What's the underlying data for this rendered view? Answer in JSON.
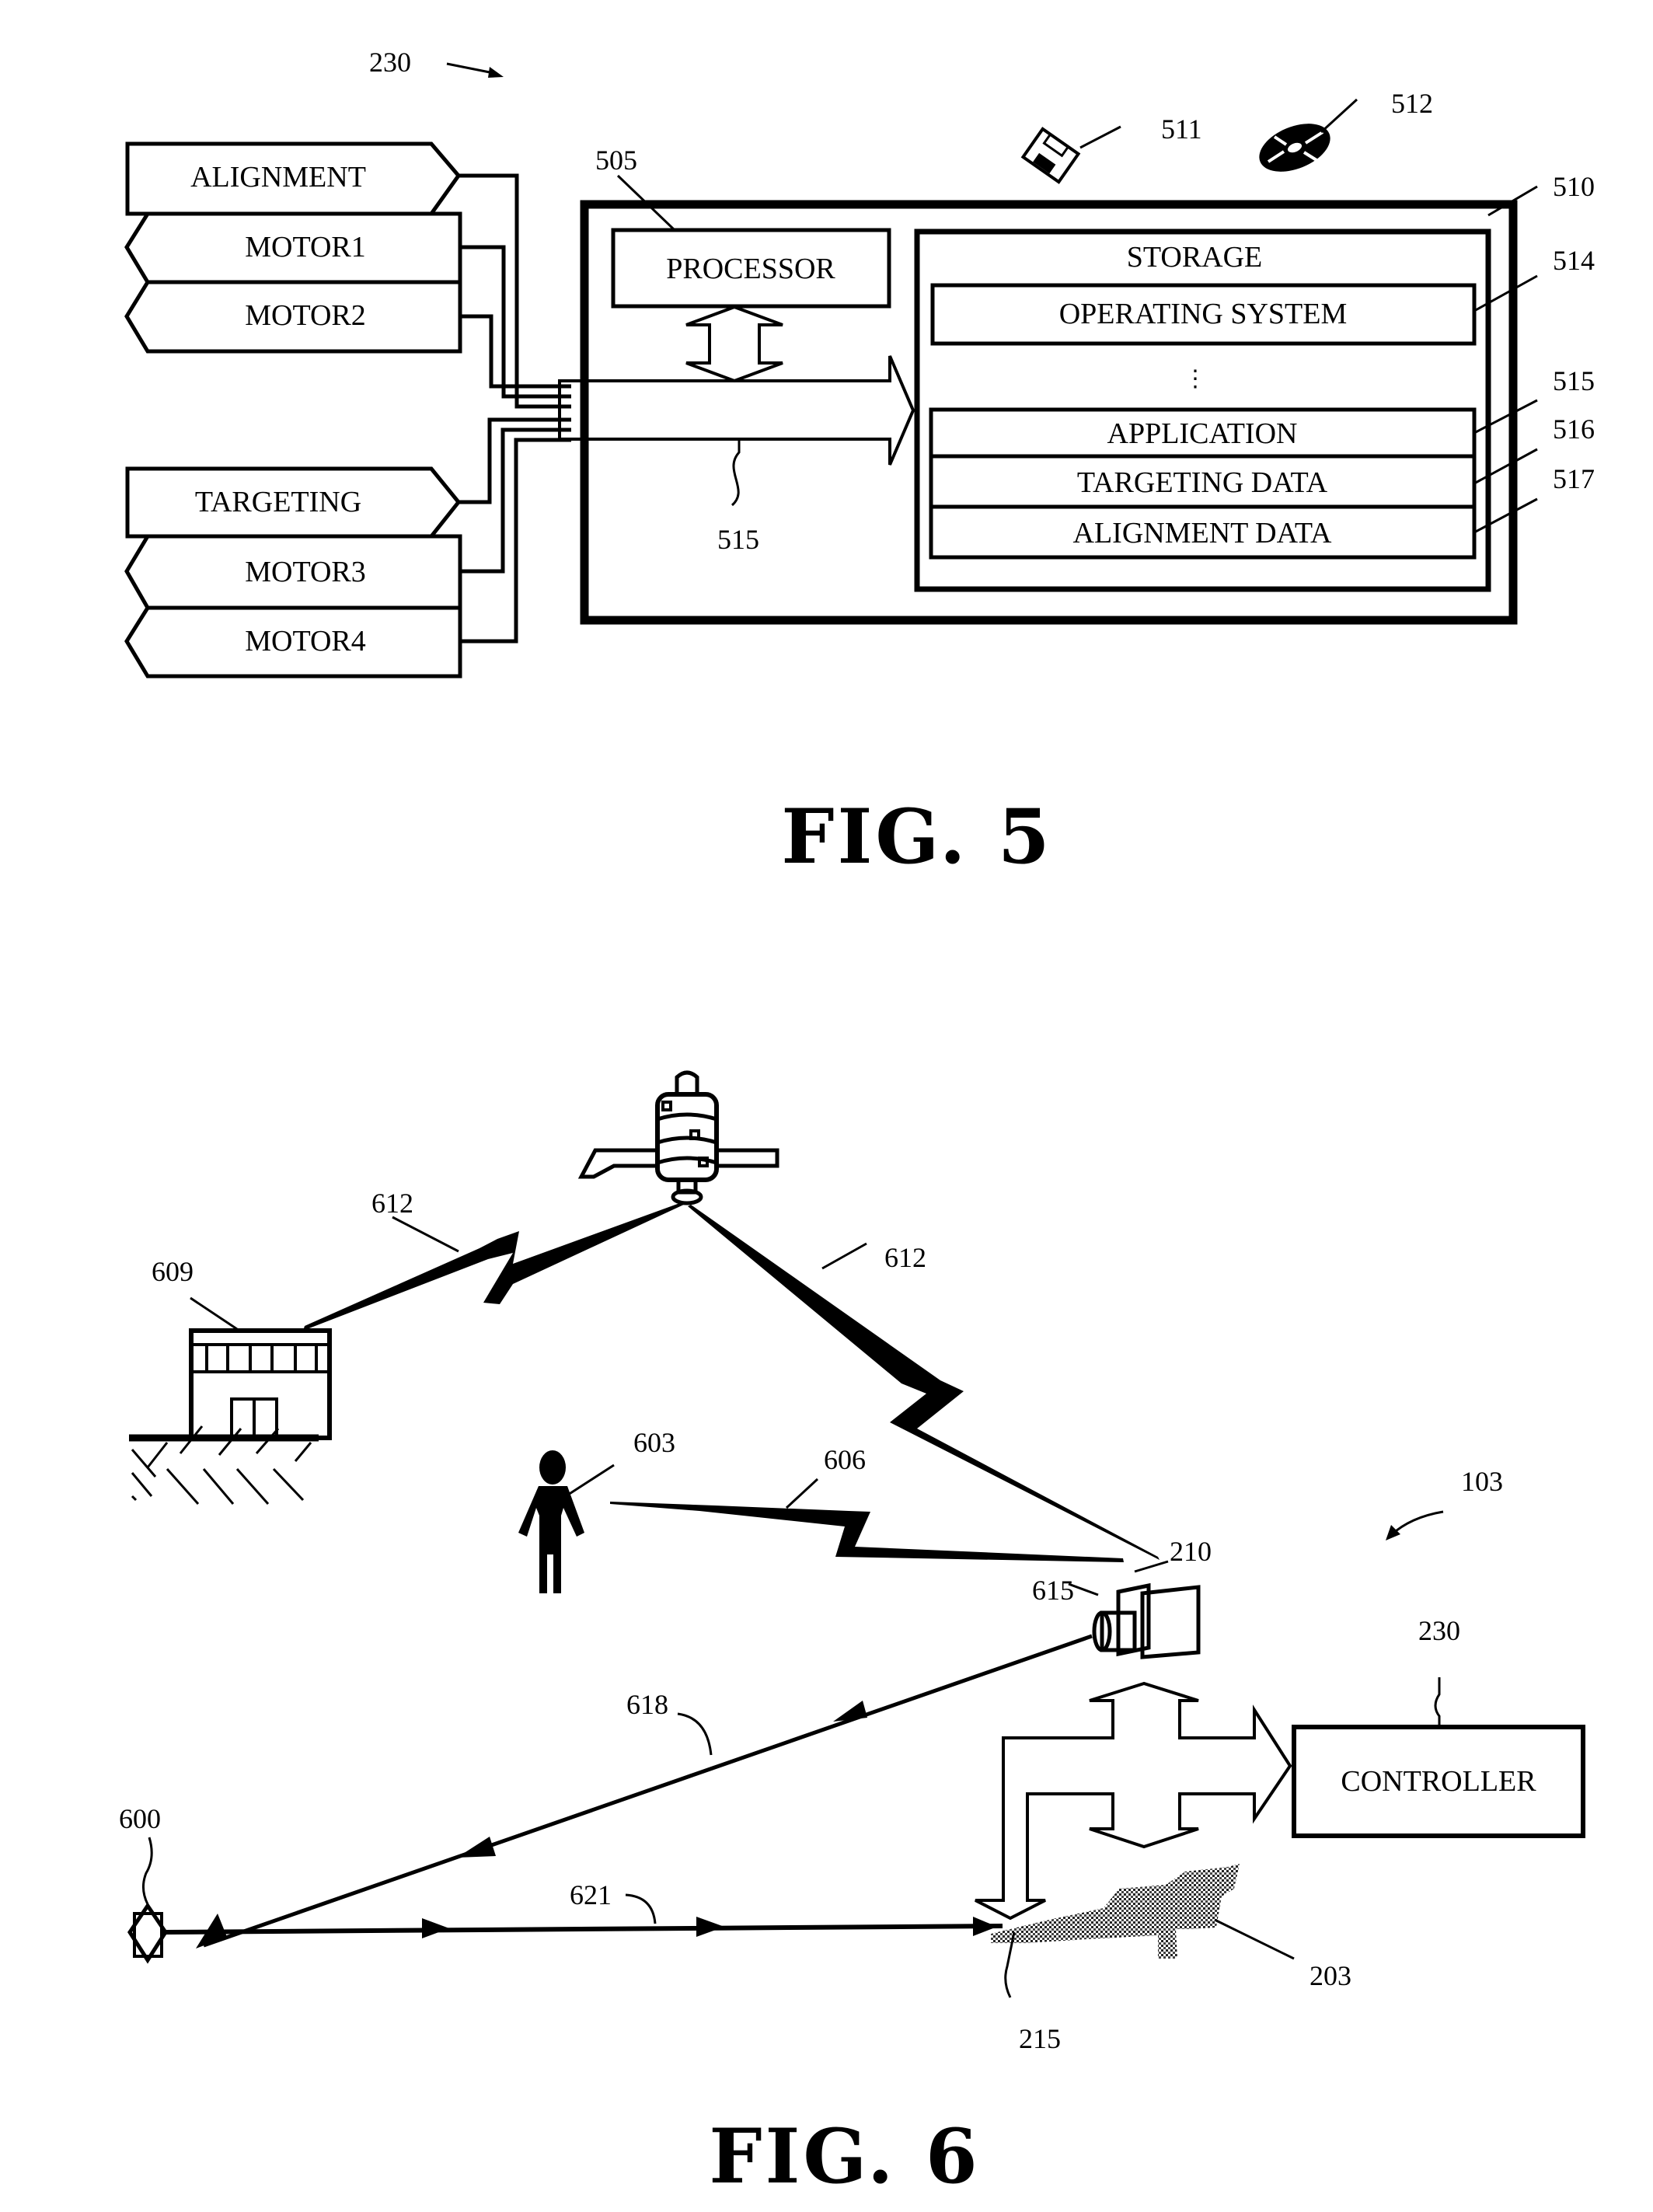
{
  "fig5": {
    "caption": "FIG. 5",
    "ref_controller": "230",
    "left_modules": {
      "alignment": "ALIGNMENT",
      "motor1": "MOTOR1",
      "motor2": "MOTOR2",
      "targeting": "TARGETING",
      "motor3": "MOTOR3",
      "motor4": "MOTOR4"
    },
    "processor": {
      "label": "PROCESSOR",
      "ref": "505"
    },
    "bus_ref": "515",
    "computer_ref": "510",
    "media": {
      "floppy_ref": "511",
      "disc_ref": "512"
    },
    "storage": {
      "label": "STORAGE",
      "operating_system": "OPERATING SYSTEM",
      "os_ref": "514",
      "ellipsis": "⋮",
      "application": "APPLICATION",
      "application_ref": "515",
      "targeting_data": "TARGETING DATA",
      "targeting_data_ref": "516",
      "alignment_data": "ALIGNMENT DATA",
      "alignment_data_ref": "517"
    }
  },
  "fig6": {
    "caption": "FIG. 6",
    "refs": {
      "satellite_link_left": "612",
      "satellite_link_right": "612",
      "building": "609",
      "person": "603",
      "person_link": "606",
      "system": "103",
      "camera": "210",
      "lens": "615",
      "controller": "230",
      "outgoing_beam": "618",
      "target": "600",
      "return_beam": "621",
      "weapon": "203",
      "muzzle": "215"
    },
    "controller_label": "CONTROLLER"
  }
}
